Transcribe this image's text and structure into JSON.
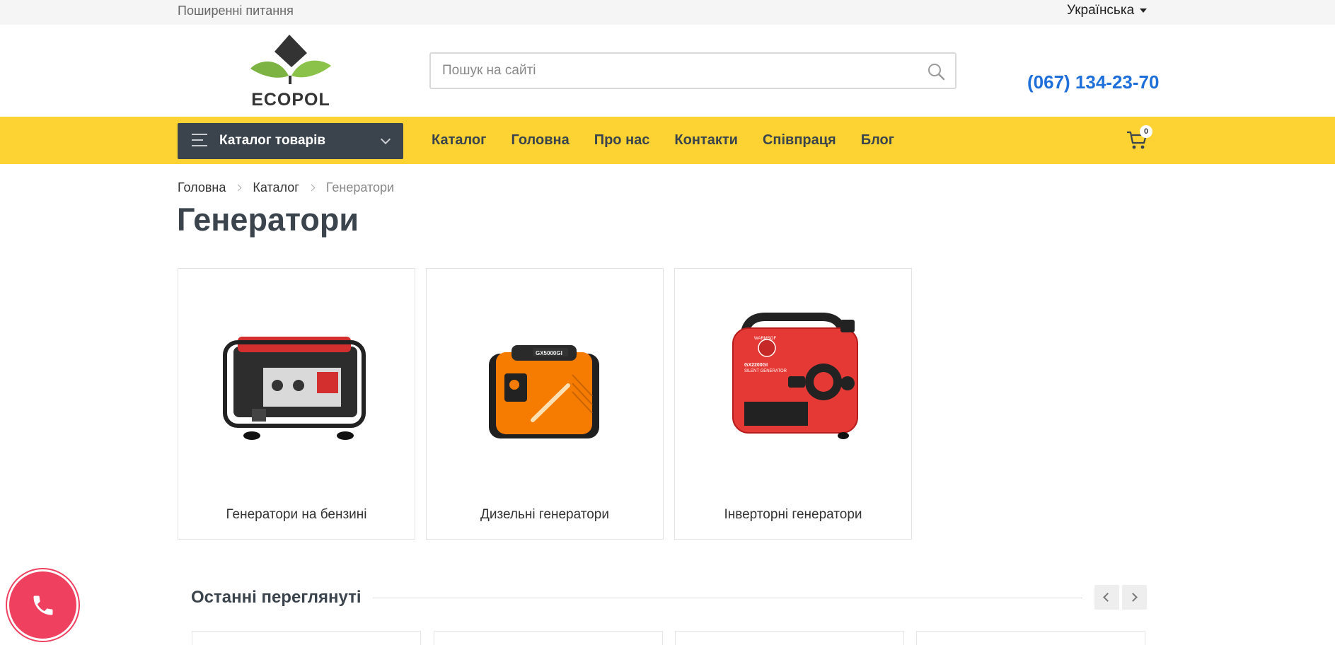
{
  "topbar": {
    "faq_link": "Поширенні питання",
    "language": "Українська"
  },
  "header": {
    "logo_text": "ECOPOL",
    "search_placeholder": "Пошук на сайті",
    "phone": "(067) 134-23-70"
  },
  "nav": {
    "catalog_button": "Каталог товарів",
    "menu": [
      "Каталог",
      "Головна",
      "Про нас",
      "Контакти",
      "Співпраця",
      "Блог"
    ],
    "cart_count": "0"
  },
  "breadcrumb": [
    "Головна",
    "Каталог",
    "Генератори"
  ],
  "page_title": "Генератори",
  "categories": [
    {
      "name": "Генератори на бензині"
    },
    {
      "name": "Дизельні генератори"
    },
    {
      "name": "Інверторні генератори"
    }
  ],
  "recent": {
    "title": "Останні переглянуті"
  },
  "product_labels": {
    "orange": "GX5000GI",
    "red": "GX2200GI",
    "red_sub": "SILENT GENERATOR",
    "brand": "WARMSOF"
  },
  "colors": {
    "accent_yellow": "#fdd334",
    "dark": "#3b444c",
    "phone_blue": "#1e6fd9",
    "call_red": "#ef4060"
  }
}
